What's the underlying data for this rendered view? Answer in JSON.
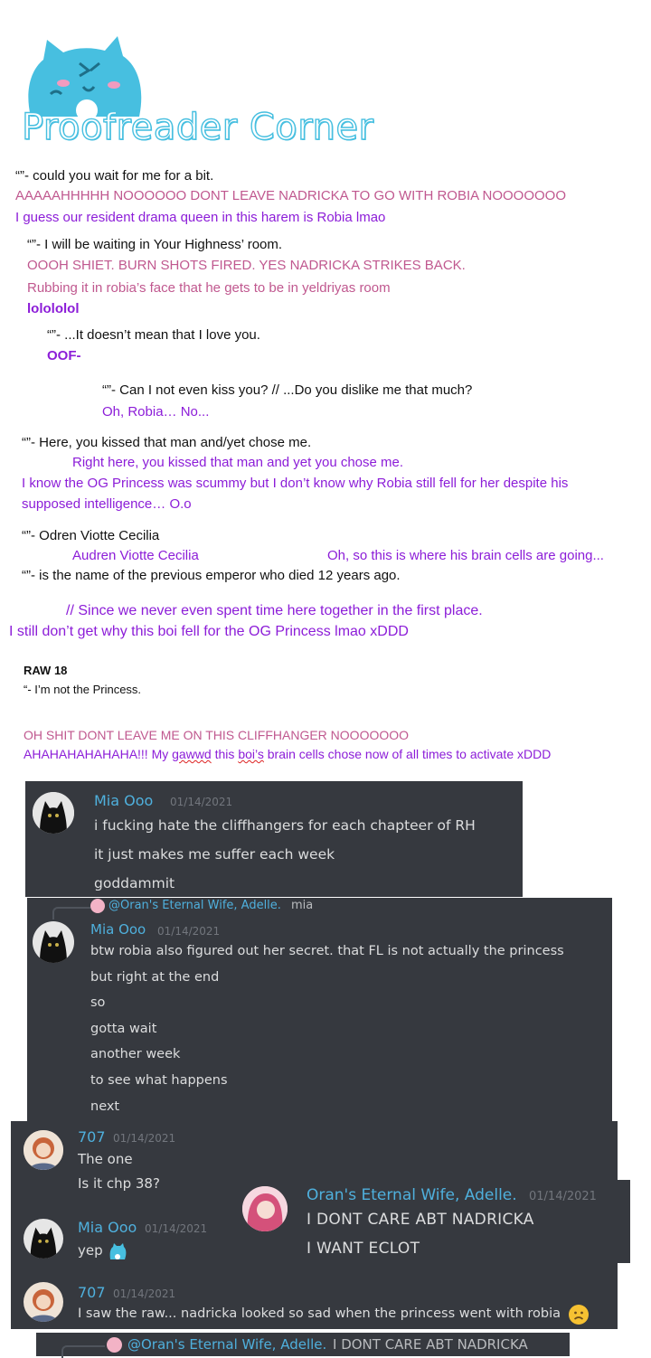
{
  "header": {
    "title": "Proofreader Corner"
  },
  "doc_lines": [
    "“”- could you wait for me for a bit.",
    "AAAAAHHHHH NOOOOOO DONT LEAVE NADRICKA TO GO WITH ROBIA NOOOOOOO",
    "I guess our resident drama queen in this harem is Robia lmao",
    "“”- I will be waiting in Your Highness’ room.",
    "OOOH SHIET. BURN  SHOTS FIRED. YES NADRICKA STRIKES BACK.",
    "Rubbing it in robia’s face that he gets to be in yeldriyas  room",
    "lolololol",
    "“”- ...It doesn’t mean that I love you.",
    "OOF-",
    "“”- Can I not even kiss you?  // ...Do you dislike me that much?",
    "Oh, Robia… No...",
    "“”- Here, you kissed that man and/yet chose me.",
    "Right here, you kissed that man and yet you chose me.",
    "I know the OG Princess was scummy but I don’t know why Robia still fell for her despite his",
    "supposed intelligence… O.o",
    "“”- Odren Viotte Cecilia",
    "Audren Viotte Cecilia",
    "Oh, so this is where his brain cells are going...",
    "“”- is the name of the previous emperor who died 12 years ago.",
    "// Since we never even spent time here together in the first place.",
    "I still don’t get why this boi fell for the OG Princess lmao xDDD",
    "RAW 18",
    "“- I’m not the Princess.",
    "OH SHIT DONT LEAVE ME ON THIS CLIFFHANGER NOOOOOOO",
    "AHAHAHAHAHAHA!!! My ",
    "gawwd",
    " this ",
    "boi’s",
    " brain cells chose now of all times to activate xDDD"
  ],
  "discord": {
    "block1": {
      "name": "Mia Ooo",
      "time": "01/14/2021",
      "lines": [
        "i fucking hate the cliffhangers for each chapteer of RH",
        "it just makes me suffer each week",
        "goddammit"
      ]
    },
    "block2": {
      "reply_name": "@Oran's Eternal Wife, Adelle.",
      "reply_text": "mia",
      "name": "Mia Ooo",
      "time": "01/14/2021",
      "lines": [
        "btw  robia  also figured out her secret. that FL is not actually  the princess",
        "but right at the end",
        "so",
        "gotta wait",
        "another  week",
        "to see what happens",
        "next"
      ]
    },
    "block3": {
      "name": "707",
      "time": "01/14/2021",
      "lines": [
        "The one",
        "Is it chp 38?"
      ]
    },
    "block4": {
      "name": "Oran's Eternal Wife, Adelle.",
      "time": "01/14/2021",
      "lines": [
        "I DONT CARE ABT NADRICKA",
        "I WANT ECLOT"
      ]
    },
    "block5": {
      "name": "Mia Ooo",
      "time": "01/14/2021",
      "text": "yep"
    },
    "block6": {
      "name": "707",
      "time": "01/14/2021",
      "text": "I saw the raw... nadricka looked so sad when the princess went with robia"
    },
    "block7": {
      "reply_name": "@Oran's Eternal Wife, Adelle.",
      "reply_text": "I DONT CARE ABT NADRICKA"
    }
  },
  "icons": [
    "cat-mascot-logo",
    "black-cat-avatar",
    "anime-girl-avatar",
    "pink-hair-avatar",
    "sad-face-emoji",
    "cat-emoji"
  ],
  "colors": {
    "pink": "#c0588f",
    "purple": "#8c1dd8",
    "discord_bg": "#36393f",
    "name_blue": "#4fb0dd",
    "title_blue": "#47bfe0"
  }
}
